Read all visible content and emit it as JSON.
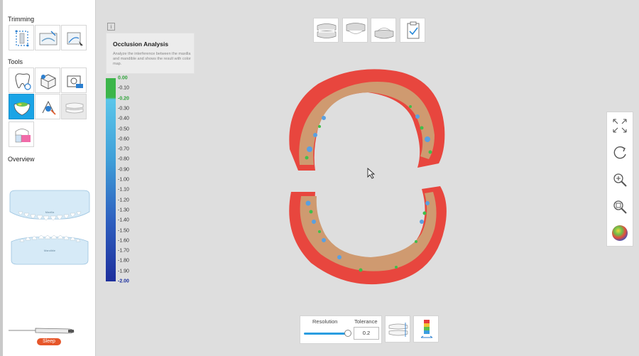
{
  "sidebar": {
    "trimming_title": "Trimming",
    "tools_title": "Tools",
    "overview_title": "Overview",
    "overview_upper_label": "Maxilla",
    "overview_lower_label": "Mandible",
    "trimming_tools": [
      "select-region-icon",
      "plane-cut-icon",
      "freeform-cut-icon"
    ],
    "tools": [
      "tooth-restore-icon",
      "block-out-icon",
      "capture-icon",
      "occlusion-analysis-icon",
      "spray-icon",
      "bite-align-icon",
      "model-base-icon"
    ],
    "status": "Sleep"
  },
  "tooltip": {
    "title": "Occlusion Analysis",
    "description": "Analyze the interference between the maxilla and mandible and shows the result with color map."
  },
  "color_scale": {
    "labels": [
      "0.00",
      "-0.10",
      "-0.20",
      "-0.30",
      "-0.40",
      "-0.50",
      "-0.60",
      "-0.70",
      "-0.80",
      "-0.90",
      "-1.00",
      "-1.10",
      "-1.20",
      "-1.30",
      "-1.40",
      "-1.50",
      "-1.60",
      "-1.70",
      "-1.80",
      "-1.90",
      "-2.00"
    ],
    "colors": {
      "green": "#3cb54a",
      "light_blue": "#5bc0e8",
      "dark_blue": "#1e2f9c",
      "label_green": "#2fa33a",
      "label_blue": "#1b2f9e"
    }
  },
  "view_buttons": [
    "both-jaws-icon",
    "maxilla-icon",
    "mandible-icon",
    "checklist-icon"
  ],
  "right_tools": [
    "fit-screen-icon",
    "rotate-icon",
    "zoom-in-icon",
    "zoom-area-icon",
    "color-map-icon"
  ],
  "bottom": {
    "resolution_label": "Resolution",
    "tolerance_label": "Tolerance",
    "tolerance_value": "0.2",
    "resolution_level": 0.92
  },
  "bottom_buttons": [
    "bite-distance-icon",
    "color-range-icon"
  ]
}
